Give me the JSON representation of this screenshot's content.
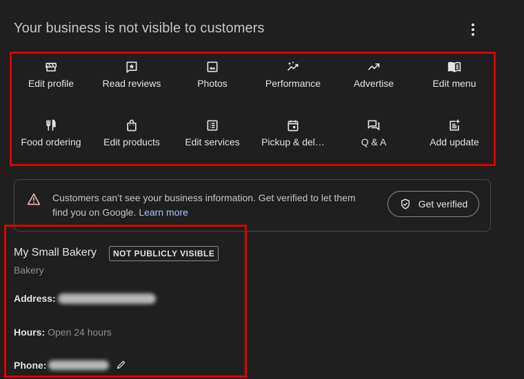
{
  "header": {
    "title": "Your business is not visible to customers",
    "more_icon": "kebab-menu-icon"
  },
  "actions": [
    {
      "label": "Edit profile",
      "icon": "storefront-icon"
    },
    {
      "label": "Read reviews",
      "icon": "star-box-icon"
    },
    {
      "label": "Photos",
      "icon": "image-icon"
    },
    {
      "label": "Performance",
      "icon": "sparkle-trend-icon"
    },
    {
      "label": "Advertise",
      "icon": "trending-up-icon"
    },
    {
      "label": "Edit menu",
      "icon": "menu-book-icon"
    },
    {
      "label": "Food ordering",
      "icon": "restaurant-icon"
    },
    {
      "label": "Edit products",
      "icon": "shopping-bag-icon"
    },
    {
      "label": "Edit services",
      "icon": "list-box-icon"
    },
    {
      "label": "Pickup & del…",
      "icon": "calendar-icon"
    },
    {
      "label": "Q & A",
      "icon": "chat-bubbles-icon"
    },
    {
      "label": "Add update",
      "icon": "post-add-icon"
    }
  ],
  "alert": {
    "icon": "warning-icon",
    "text": "Customers can’t see your business information. Get verified to let them find you on Google.",
    "link": "Learn more",
    "button_label": "Get verified",
    "button_icon": "verified-shield-icon"
  },
  "business": {
    "name": "My Small Bakery",
    "badge": "NOT PUBLICLY VISIBLE",
    "category": "Bakery",
    "address_label": "Address:",
    "hours_label": "Hours:",
    "hours_value": "Open 24 hours",
    "phone_label": "Phone:"
  },
  "colors": {
    "background": "#1f1f1f",
    "highlight": "#e00000",
    "link": "#a8c7fa",
    "warning": "#f2b8b5"
  }
}
